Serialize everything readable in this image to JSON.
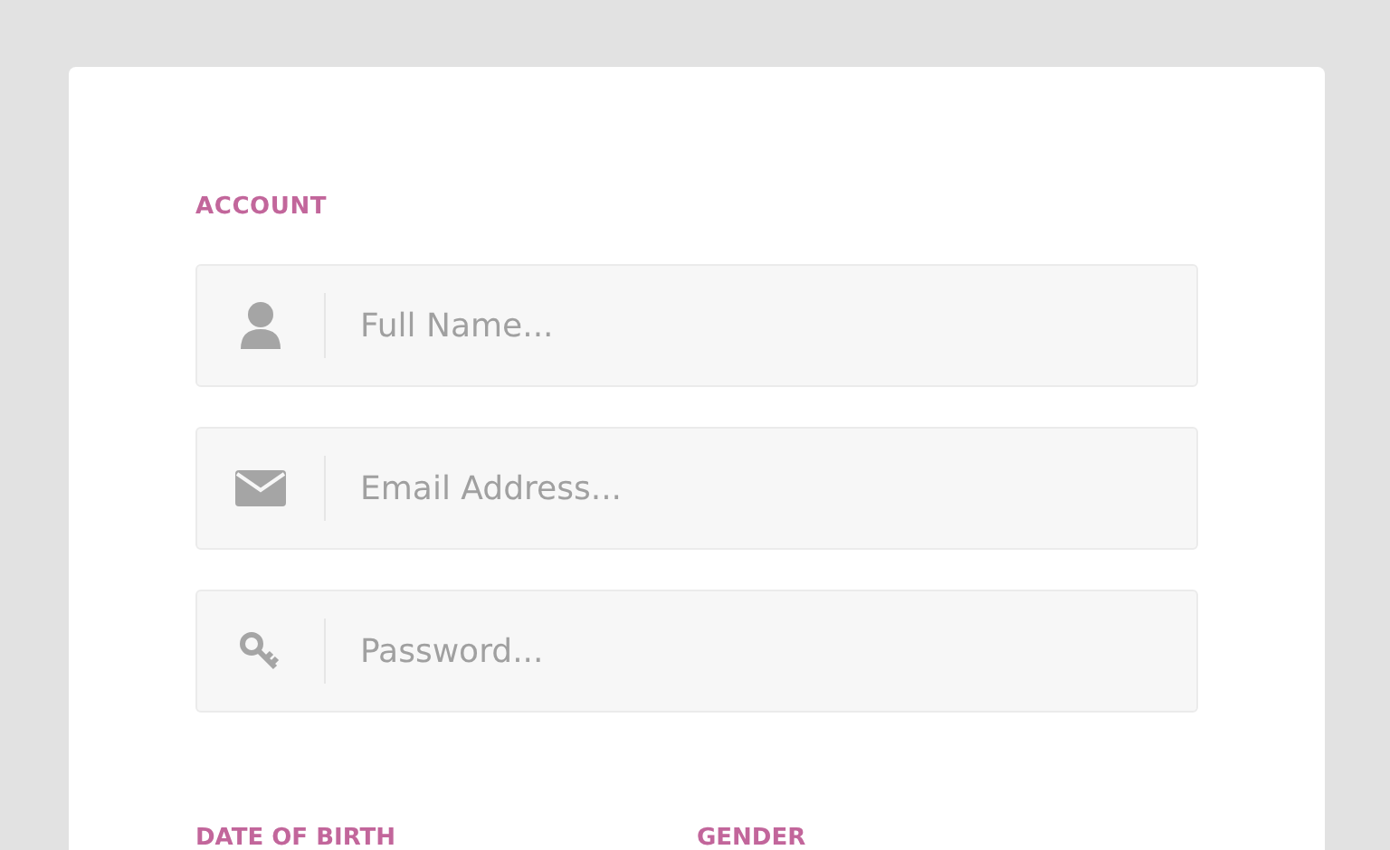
{
  "section_title": "ACCOUNT",
  "fields": [
    {
      "kind": "user",
      "placeholder": "Full Name..."
    },
    {
      "kind": "email",
      "placeholder": "Email Address..."
    },
    {
      "kind": "password",
      "placeholder": "Password..."
    }
  ],
  "next_labels": [
    "DATE OF BIRTH",
    "GENDER"
  ]
}
